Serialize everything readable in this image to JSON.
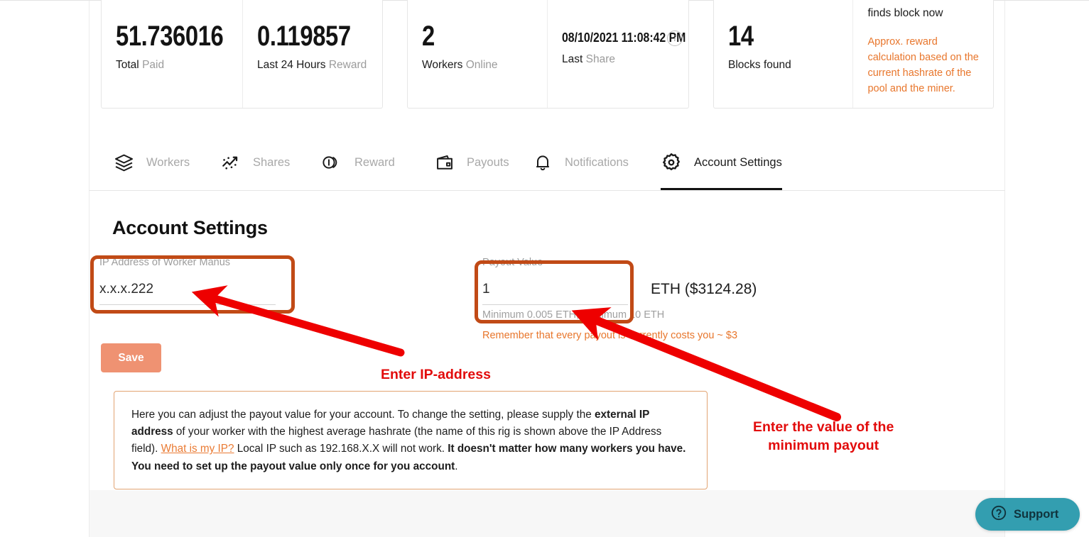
{
  "stats": [
    {
      "id": "total-paid",
      "value": "51.736016",
      "label_main": "Total",
      "label_muted": "Paid"
    },
    {
      "id": "last-24h-reward",
      "value": "0.119857",
      "label_main": "Last 24 Hours",
      "label_muted": "Reward"
    },
    {
      "id": "workers-online",
      "value": "2",
      "label_main": "Workers",
      "label_muted": "Online"
    },
    {
      "id": "last-share",
      "value": "08/10/2021 11:08:42 PM",
      "label_main": "Last",
      "label_muted": "Share",
      "info_icon": "i"
    },
    {
      "id": "blocks-found",
      "value": "14",
      "label_main": "Blocks found",
      "label_muted": ""
    },
    {
      "id": "reward-note",
      "top_text": "finds block now",
      "note": "Approx. reward calculation based on the current hashrate of the pool and the miner.",
      "note_color": "#e8762c"
    }
  ],
  "tabs": [
    {
      "id": "workers",
      "label": "Workers",
      "icon": "layers-icon",
      "active": false
    },
    {
      "id": "shares",
      "label": "Shares",
      "icon": "scatter-chart-icon",
      "active": false
    },
    {
      "id": "reward",
      "label": "Reward",
      "icon": "coins-icon",
      "active": false
    },
    {
      "id": "payouts",
      "label": "Payouts",
      "icon": "wallet-icon",
      "active": false
    },
    {
      "id": "notif",
      "label": "Notifications",
      "icon": "bell-icon",
      "active": false
    },
    {
      "id": "settings",
      "label": "Account Settings",
      "icon": "gear-icon",
      "active": true
    }
  ],
  "page": {
    "title": "Account Settings"
  },
  "form": {
    "ip_field": {
      "label": "IP Address of Worker Manus",
      "value": "x.x.x.222"
    },
    "payout_field": {
      "label": "Payout Value",
      "value": "1",
      "hint": "Minimum 0.005 ETH, Maximum 10 ETH",
      "warning": "Remember that every payout is currently costs you ~ $3",
      "suffix": "ETH  ($3124.28)"
    },
    "save_label": "Save"
  },
  "info_box": {
    "p1": "Here you can adjust the payout value for your account. To change the setting, please supply the ",
    "b1": "external IP address",
    "p2": " of your worker with the highest average hashrate (the name of this rig is shown above the IP Address field). ",
    "link": "What is my IP?",
    "p3": " Local IP such as 192.168.X.X will not work. ",
    "b2": "It doesn't matter how many workers you have. You need to set up the payout value only once for you account",
    "p4": "."
  },
  "support": {
    "label": "Support",
    "icon": "question-circle-icon",
    "color": "#339eb0"
  },
  "annotations": [
    {
      "id": "enter-ip",
      "text": "Enter IP-address",
      "color": "#e20b0b"
    },
    {
      "id": "enter-payout",
      "text": "Enter the value of the\nminimum payout",
      "color": "#e20b0b"
    }
  ],
  "highlight_color": "#c14a16"
}
